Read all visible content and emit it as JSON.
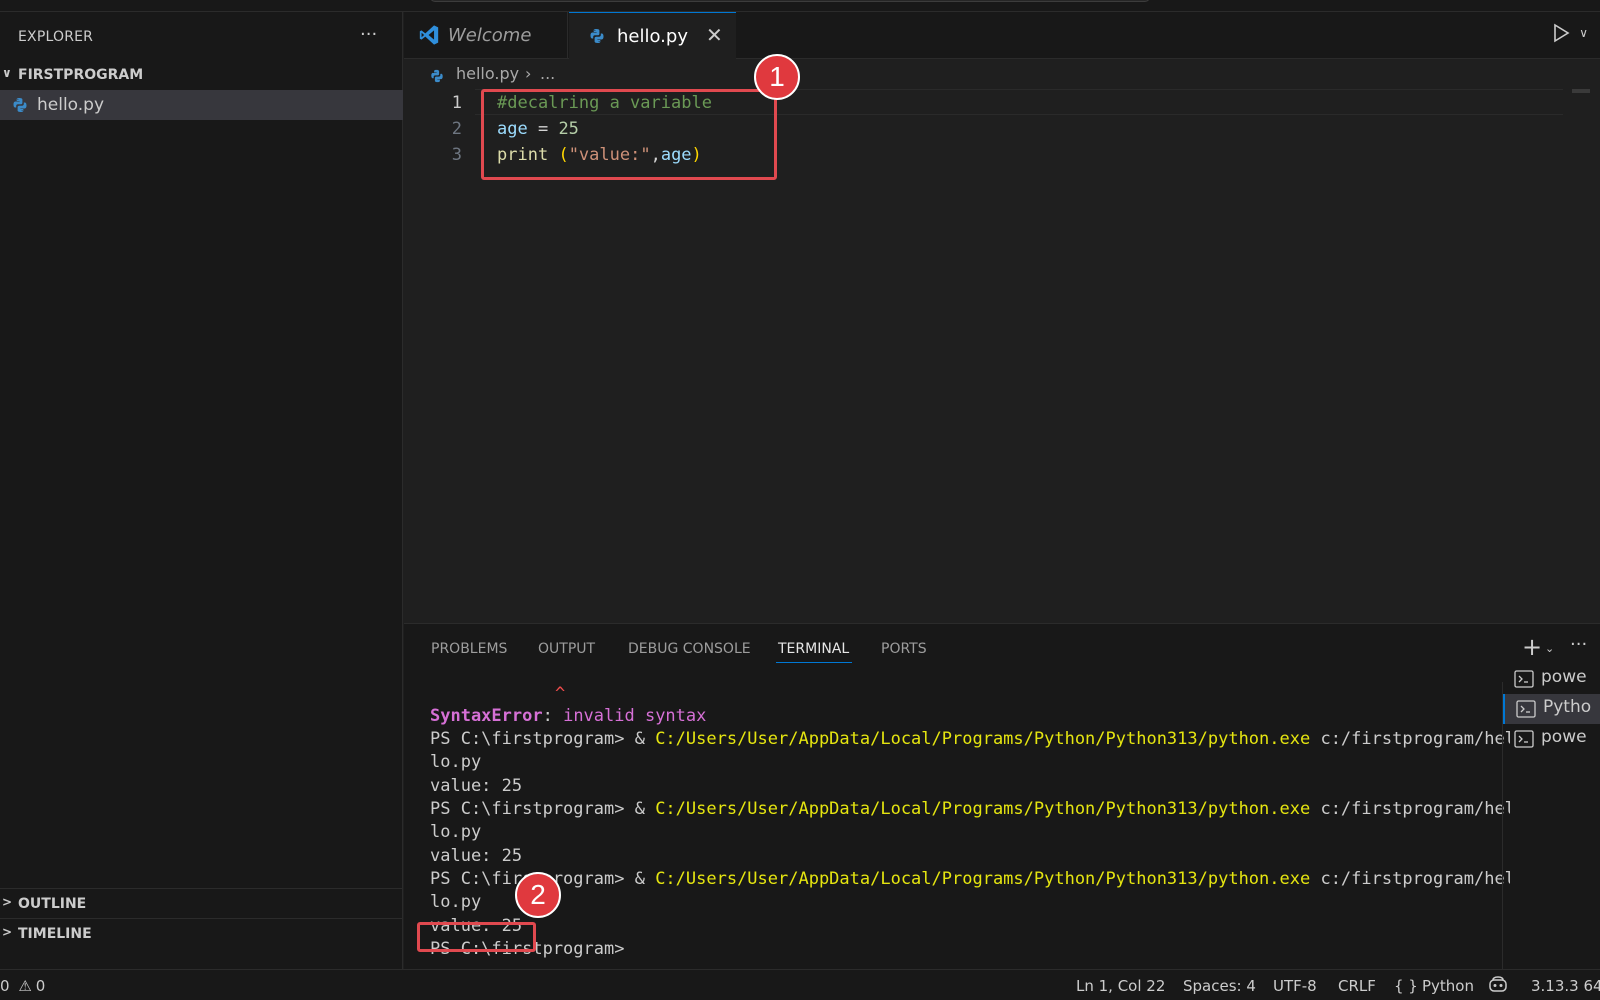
{
  "sidebar": {
    "title": "EXPLORER",
    "more_label": "···",
    "folder_name": "FIRSTPROGRAM",
    "files": [
      {
        "name": "hello.py"
      }
    ],
    "sections": [
      {
        "label": "OUTLINE"
      },
      {
        "label": "TIMELINE"
      }
    ]
  },
  "tabs": [
    {
      "label": "Welcome",
      "icon": "vscode-logo-icon"
    },
    {
      "label": "hello.py",
      "icon": "python-file-icon",
      "close": "✕"
    }
  ],
  "breadcrumb": {
    "file": "hello.py",
    "separator": "›",
    "rest": "..."
  },
  "editor": {
    "line_numbers": [
      "1",
      "2",
      "3"
    ],
    "line1": {
      "comment": "#decalring a variable"
    },
    "line2": {
      "var": "age",
      "op": " = ",
      "num": "25"
    },
    "line3": {
      "fn": "print",
      "sp": " ",
      "lp": "(",
      "str": "\"value:\"",
      "comma": ",",
      "arg": "age",
      "rp": ")"
    }
  },
  "annotations": [
    {
      "label": "1"
    },
    {
      "label": "2"
    }
  ],
  "panel": {
    "tabs": [
      "PROBLEMS",
      "OUTPUT",
      "DEBUG CONSOLE",
      "TERMINAL",
      "PORTS"
    ],
    "active_tab": "TERMINAL",
    "add_label": "+",
    "chevron_label": "⌄",
    "more_label": "···",
    "terminal_lines": {
      "caret": "^",
      "error_name": "SyntaxError",
      "error_colon": ": ",
      "error_msg": "invalid syntax",
      "prompt": "PS C:\\firstprogram> ",
      "amp": "& ",
      "exe": "C:/Users/User/AppData/Local/Programs/Python/Python313/python.exe",
      "script": " c:/firstprogram/hel",
      "wrap": "lo.py",
      "output": "value: 25",
      "final_prompt": "PS C:\\firstprogram>"
    },
    "terminal_list": [
      {
        "label": "powe",
        "selected": false
      },
      {
        "label": "Pytho",
        "selected": true
      },
      {
        "label": "powe",
        "selected": false
      }
    ]
  },
  "statusbar": {
    "errors": "0",
    "warnings": "0",
    "position": "Ln 1, Col 22",
    "spaces": "Spaces: 4",
    "encoding": "UTF-8",
    "eol": "CRLF",
    "language_braces": "{ }",
    "language": "Python",
    "interpreter": "3.13.3 64-"
  },
  "colors": {
    "accent": "#0078d4",
    "annotation": "#e0393e",
    "editor_bg": "#1f1f1f",
    "sidebar_bg": "#181818"
  }
}
